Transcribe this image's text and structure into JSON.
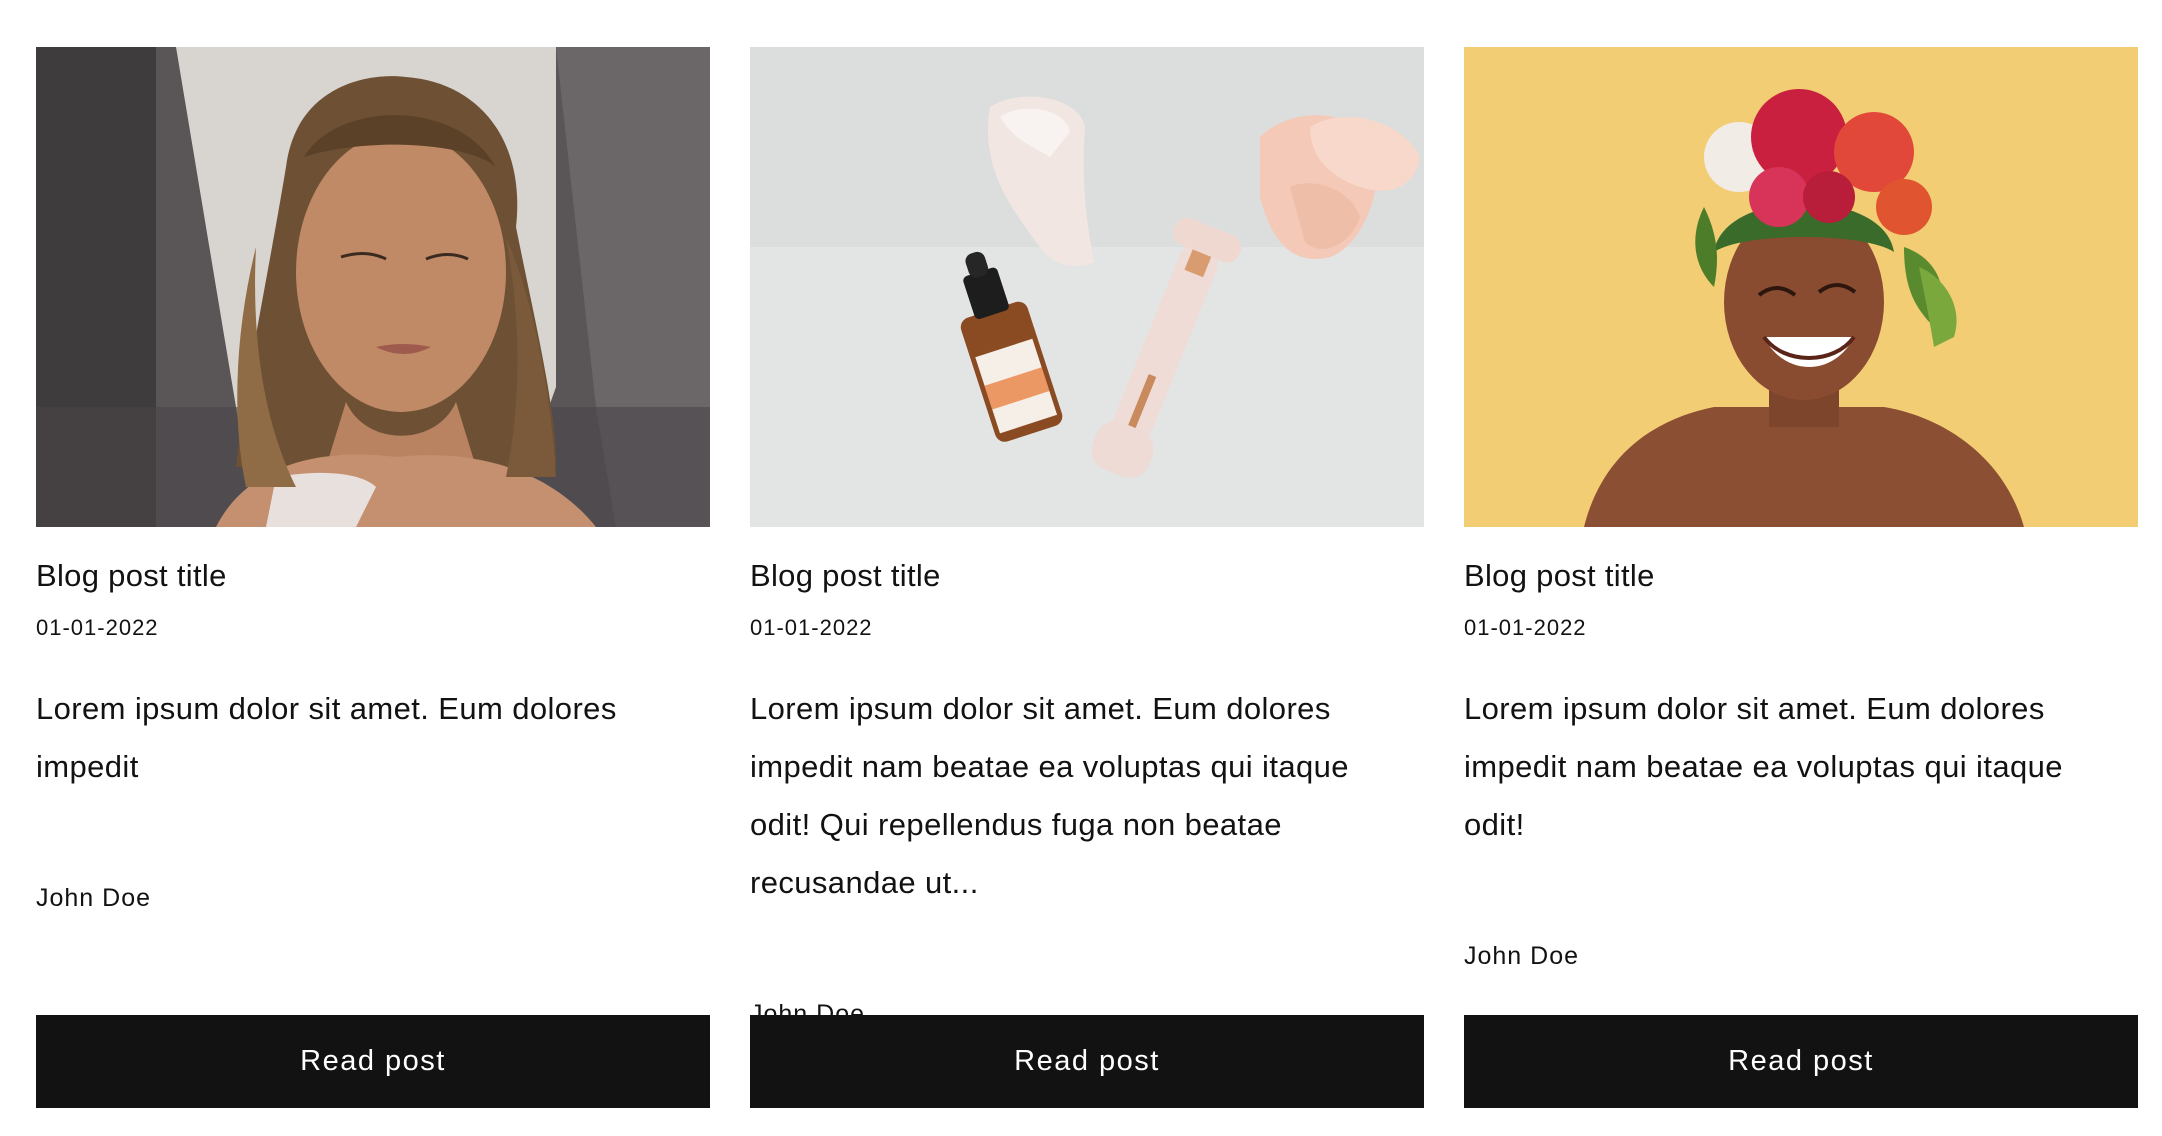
{
  "posts": [
    {
      "image_alt": "woman with wet hair and closed eyes",
      "title": "Blog post title",
      "date": "01-01-2022",
      "excerpt": "Lorem ipsum dolor sit amet. Eum dolores impedit",
      "author": "John Doe",
      "button_label": "Read post"
    },
    {
      "image_alt": "serum bottle, facial roller and rose quartz stones",
      "title": "Blog post title",
      "date": "01-01-2022",
      "excerpt": "Lorem ipsum dolor sit amet. Eum dolores impedit nam beatae ea voluptas qui itaque odit! Qui repellendus fuga non beatae recusandae ut...",
      "author": "John Doe",
      "button_label": "Read post"
    },
    {
      "image_alt": "smiling woman wearing a flower crown",
      "title": "Blog post title",
      "date": "01-01-2022",
      "excerpt": "Lorem ipsum dolor sit amet. Eum dolores impedit nam beatae ea voluptas qui itaque odit!",
      "author": "John Doe",
      "button_label": "Read post"
    }
  ]
}
